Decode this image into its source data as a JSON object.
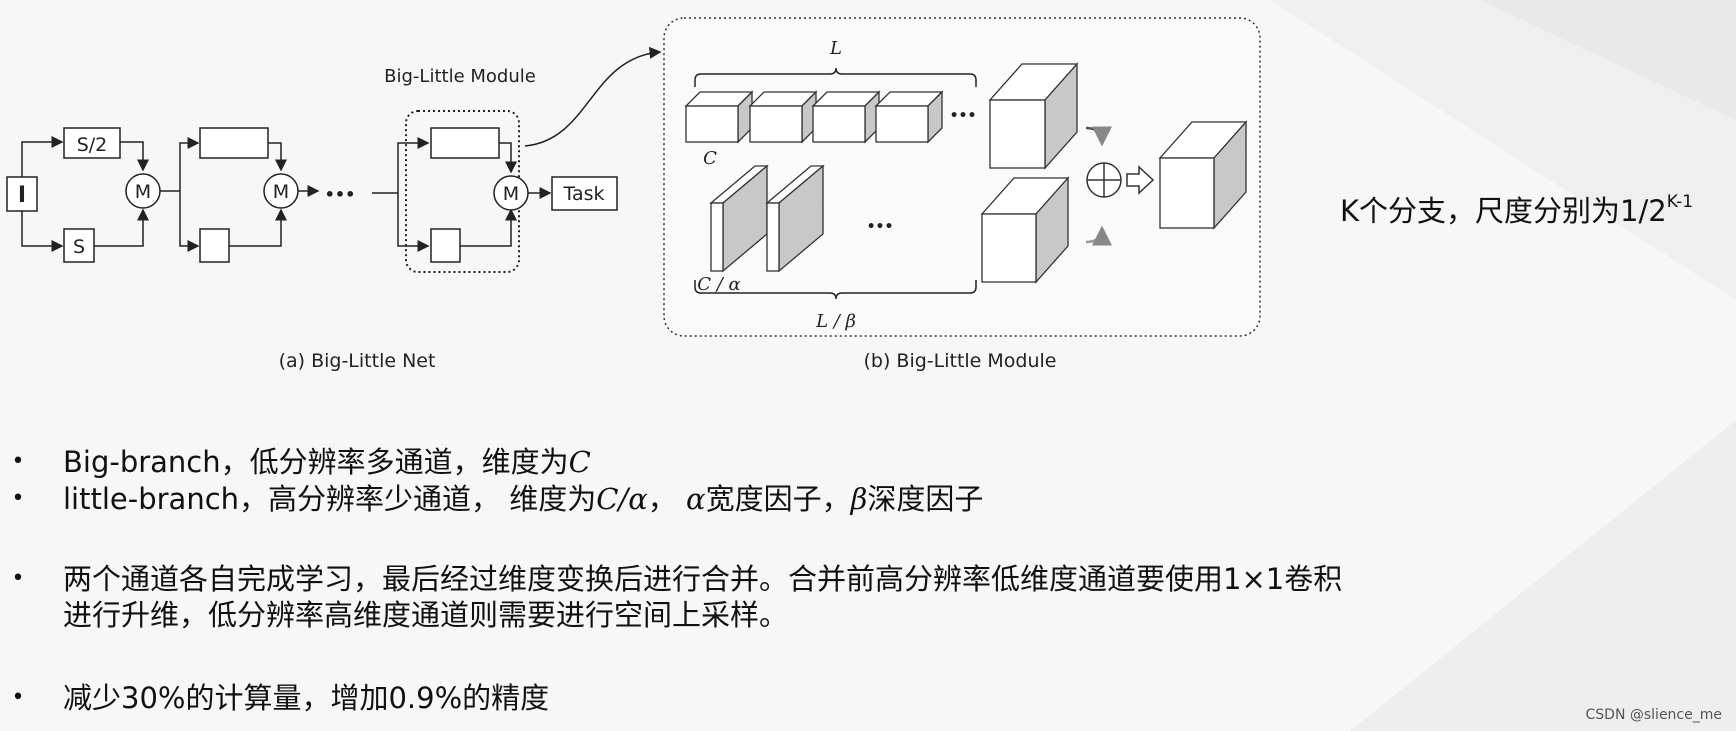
{
  "figure": {
    "net": {
      "input_label": "I",
      "upper_box_label": "S/2",
      "lower_box_label": "S",
      "merge_label": "M",
      "ellipsis": "•••",
      "task_label": "Task",
      "module_title": "Big-Little Module",
      "caption": "(a) Big-Little Net"
    },
    "module": {
      "label_L": "L",
      "label_C": "C",
      "label_C_alpha": "C / α",
      "label_L_beta": "L / β",
      "ellipsis_top": "•••",
      "ellipsis_mid": "•••",
      "caption": "(b) Big-Little Module"
    }
  },
  "side_note": {
    "text": "K个分支，尺度分别为1/2",
    "superscript": "K-1"
  },
  "bullets": [
    {
      "pre": "Big-branch，低分辨率多通道，维度为",
      "math": "C"
    },
    {
      "pre": "little-branch，高分辨率少通道， 维度为",
      "math": "C/α",
      "mid": "， ",
      "math2": "α",
      "mid2": "宽度因子，",
      "math3": "β",
      "post": "深度因子"
    },
    {
      "line1": "两个通道各自完成学习，最后经过维度变换后进行合并。合并前高分辨率低维度通道要使用1×1卷积",
      "line2": "进行升维，低分辨率高维度通道则需要进行空间上采样。"
    },
    {
      "text": "减少30%的计算量，增加0.9%的精度"
    }
  ],
  "watermark": "CSDN @slience_me"
}
